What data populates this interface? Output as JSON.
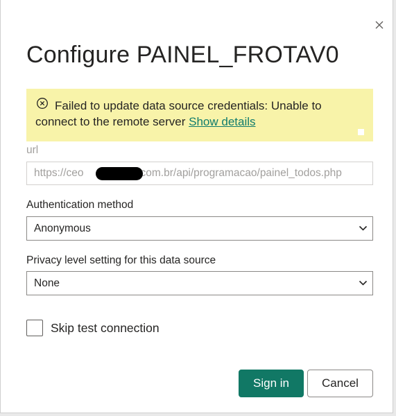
{
  "dialog": {
    "title": "Configure PAINEL_FROTAV0",
    "close_icon": "close-icon"
  },
  "banner": {
    "icon": "error-circle-icon",
    "message": "Failed to update data source credentials: Unable to connect to the remote server",
    "link_label": "Show details",
    "background": "#f8f3a9"
  },
  "url_field": {
    "label": "url",
    "value_prefix": "https://ceo",
    "value_suffix": "com.br/api/programacao/painel_todos.php"
  },
  "auth_method": {
    "label": "Authentication method",
    "selected": "Anonymous",
    "icon": "chevron-down-icon"
  },
  "privacy_level": {
    "label": "Privacy level setting for this data source",
    "selected": "None",
    "icon": "chevron-down-icon"
  },
  "skip_test": {
    "label": "Skip test connection",
    "checked": false
  },
  "buttons": {
    "sign_in": "Sign in",
    "cancel": "Cancel"
  },
  "colors": {
    "accent": "#117865",
    "link": "#107c6d"
  }
}
